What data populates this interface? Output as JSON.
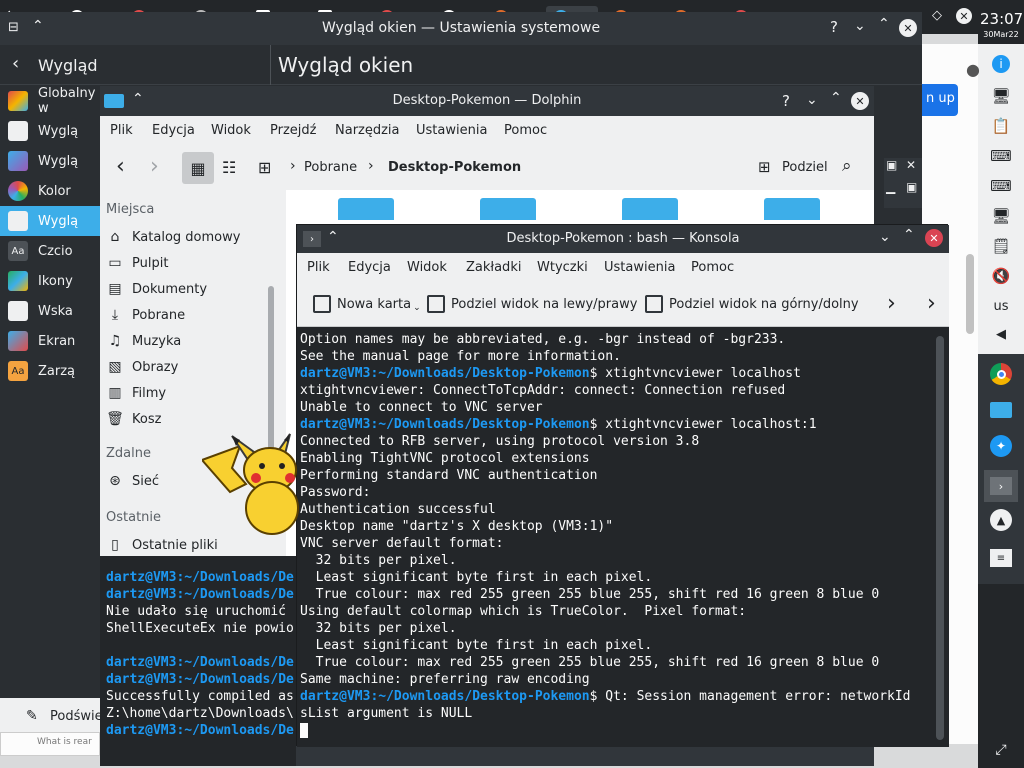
{
  "system": {
    "clock": "23:07",
    "date": "30Mar22",
    "keyboard_layout": "us"
  },
  "settings_window": {
    "title": "Wygląd okien — Ustawienia systemowe",
    "back_label": "Wygląd",
    "page_title": "Wygląd okien",
    "sidebar_items": [
      {
        "label": "Globalny w",
        "icon": "global-theme-icon"
      },
      {
        "label": "Wyglą",
        "icon": "application-style-icon"
      },
      {
        "label": "Wyglą",
        "icon": "plasma-style-icon"
      },
      {
        "label": "Kolor",
        "icon": "colors-icon"
      },
      {
        "label": "Wyglą",
        "icon": "window-decorations-icon"
      },
      {
        "label": "Czcio",
        "icon": "fonts-icon"
      },
      {
        "label": "Ikony",
        "icon": "icons-icon"
      },
      {
        "label": "Wska",
        "icon": "cursors-icon"
      },
      {
        "label": "Ekran",
        "icon": "splash-screen-icon"
      },
      {
        "label": "Zarzą",
        "icon": "font-management-icon"
      }
    ],
    "bottom_button": "Podświe"
  },
  "browser": {
    "button_label": "n up",
    "partial_text": "What is rear"
  },
  "dolphin": {
    "title": "Desktop-Pokemon — Dolphin",
    "menu": [
      "Plik",
      "Edycja",
      "Widok",
      "Przejdź",
      "Narzędzia",
      "Ustawienia",
      "Pomoc"
    ],
    "breadcrumb": [
      "Pobrane",
      "Desktop-Pokemon"
    ],
    "split_label": "Podziel",
    "places": {
      "header_places": "Miejsca",
      "items": [
        {
          "label": "Katalog domowy",
          "icon": "home-icon"
        },
        {
          "label": "Pulpit",
          "icon": "desktop-icon"
        },
        {
          "label": "Dokumenty",
          "icon": "documents-icon"
        },
        {
          "label": "Pobrane",
          "icon": "downloads-icon"
        },
        {
          "label": "Muzyka",
          "icon": "music-icon"
        },
        {
          "label": "Obrazy",
          "icon": "pictures-icon"
        },
        {
          "label": "Filmy",
          "icon": "videos-icon"
        },
        {
          "label": "Kosz",
          "icon": "trash-icon"
        }
      ],
      "header_remote": "Zdalne",
      "remote_items": [
        {
          "label": "Sieć",
          "icon": "network-icon"
        }
      ],
      "header_recent": "Ostatnie",
      "recent_items": [
        {
          "label": "Ostatnie pliki",
          "icon": "recent-files-icon"
        }
      ]
    },
    "terminal_lines": [
      {
        "prompt_user": "dartz@VM3",
        "prompt_path": ":~/Downloads/De",
        "text": ""
      },
      {
        "prompt_user": "dartz@VM3",
        "prompt_path": ":~/Downloads/De",
        "text": ""
      },
      {
        "prompt_user": "",
        "prompt_path": "",
        "text": "Nie udało się uruchomić"
      },
      {
        "prompt_user": "",
        "prompt_path": "",
        "text": "ShellExecuteEx nie powio"
      },
      {
        "prompt_user": "dartz@VM3",
        "prompt_path": ":~/Downloads/De",
        "text": ""
      },
      {
        "prompt_user": "dartz@VM3",
        "prompt_path": ":~/Downloads/De",
        "text": ""
      },
      {
        "prompt_user": "",
        "prompt_path": "",
        "text": "Successfully compiled as"
      },
      {
        "prompt_user": "",
        "prompt_path": "",
        "text": "Z:\\home\\dartz\\Downloads\\"
      },
      {
        "prompt_user": "dartz@VM3",
        "prompt_path": ":~/Downloads/De",
        "text": ""
      }
    ]
  },
  "konsole": {
    "title": "Desktop-Pokemon : bash — Konsola",
    "menu": [
      "Plik",
      "Edycja",
      "Widok",
      "Zakładki",
      "Wtyczki",
      "Ustawienia",
      "Pomoc"
    ],
    "toolbar": {
      "new_tab": "Nowa karta",
      "split_lr": "Podziel widok na lewy/prawy",
      "split_tb": "Podziel widok na górny/dolny"
    },
    "lines": [
      {
        "u": "",
        "p": "",
        "t": "Option names may be abbreviated, e.g. -bgr instead of -bgr233."
      },
      {
        "u": "",
        "p": "",
        "t": "See the manual page for more information."
      },
      {
        "u": "dartz@VM3",
        "p": ":~/Downloads/Desktop-Pokemon",
        "t": "$ xtightvncviewer localhost"
      },
      {
        "u": "",
        "p": "",
        "t": "xtightvncviewer: ConnectToTcpAddr: connect: Connection refused"
      },
      {
        "u": "",
        "p": "",
        "t": "Unable to connect to VNC server"
      },
      {
        "u": "dartz@VM3",
        "p": ":~/Downloads/Desktop-Pokemon",
        "t": "$ xtightvncviewer localhost:1"
      },
      {
        "u": "",
        "p": "",
        "t": "Connected to RFB server, using protocol version 3.8"
      },
      {
        "u": "",
        "p": "",
        "t": "Enabling TightVNC protocol extensions"
      },
      {
        "u": "",
        "p": "",
        "t": "Performing standard VNC authentication"
      },
      {
        "u": "",
        "p": "",
        "t": "Password:"
      },
      {
        "u": "",
        "p": "",
        "t": "Authentication successful"
      },
      {
        "u": "",
        "p": "",
        "t": "Desktop name \"dartz's X desktop (VM3:1)\""
      },
      {
        "u": "",
        "p": "",
        "t": "VNC server default format:"
      },
      {
        "u": "",
        "p": "",
        "t": "  32 bits per pixel."
      },
      {
        "u": "",
        "p": "",
        "t": "  Least significant byte first in each pixel."
      },
      {
        "u": "",
        "p": "",
        "t": "  True colour: max red 255 green 255 blue 255, shift red 16 green 8 blue 0"
      },
      {
        "u": "",
        "p": "",
        "t": "Using default colormap which is TrueColor.  Pixel format:"
      },
      {
        "u": "",
        "p": "",
        "t": "  32 bits per pixel."
      },
      {
        "u": "",
        "p": "",
        "t": "  Least significant byte first in each pixel."
      },
      {
        "u": "",
        "p": "",
        "t": "  True colour: max red 255 green 255 blue 255, shift red 16 green 8 blue 0"
      },
      {
        "u": "",
        "p": "",
        "t": "Same machine: preferring raw encoding"
      },
      {
        "u": "dartz@VM3",
        "p": ":~/Downloads/Desktop-Pokemon",
        "t": "$ Qt: Session management error: networkId"
      },
      {
        "u": "",
        "p": "",
        "t": "sList argument is NULL"
      }
    ]
  },
  "colors": {
    "prompt": "#1d99f3",
    "accent": "#3daee9",
    "close_red": "#da4453"
  }
}
